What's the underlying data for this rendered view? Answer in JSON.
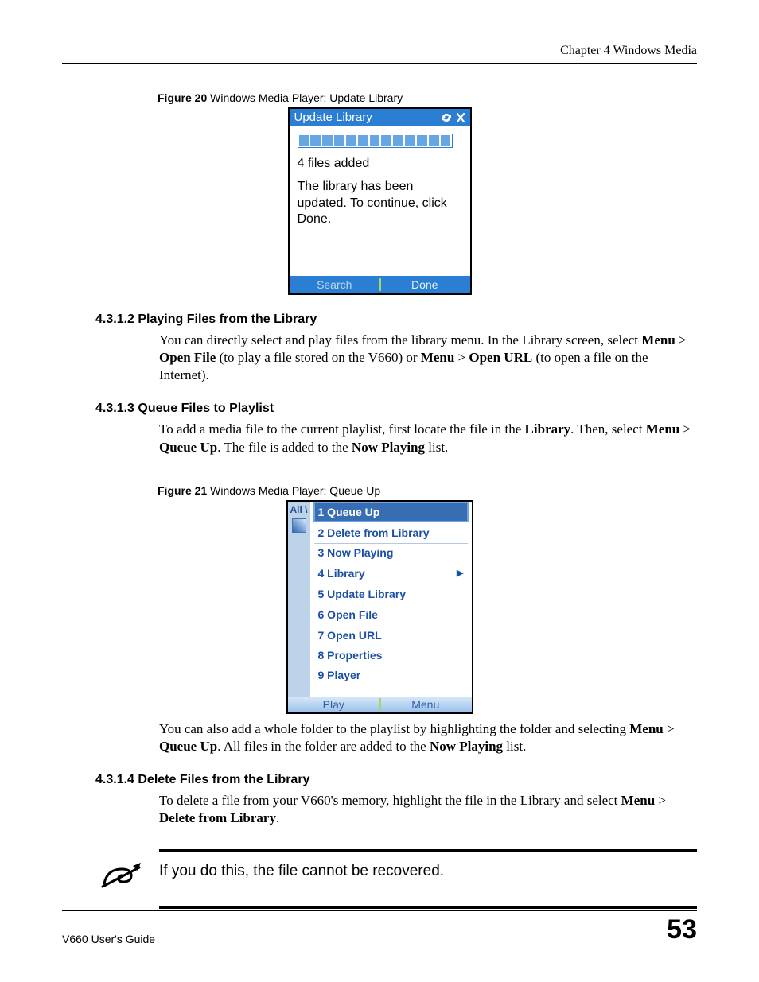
{
  "header": {
    "chapter": "Chapter 4 Windows Media"
  },
  "fig20": {
    "caption_bold": "Figure 20",
    "caption_rest": "   Windows Media Player: Update Library",
    "title": "Update Library",
    "status": "4 files added",
    "message": "The library has been updated. To continue, click Done.",
    "btn_left": "Search",
    "btn_right": "Done"
  },
  "sec4312": {
    "heading": "4.3.1.2  Playing Files from the Library",
    "p1a": "You can directly select and play files from the library menu. In the Library screen, select ",
    "menu": "Menu",
    "gt": " > ",
    "openfile": "Open File",
    "p1b": " (to play a file stored on the V660) or ",
    "openurl": "Open URL",
    "p1c": " (to open a file on the Internet)."
  },
  "sec4313": {
    "heading": "4.3.1.3  Queue Files to Playlist",
    "p1a": "To add a media file to the current playlist, first locate the file in the ",
    "library": "Library",
    "p1b": ". Then, select ",
    "menu": "Menu",
    "gt": " > ",
    "queueup": "Queue Up",
    "p1c": ". The file is added to the ",
    "nowplaying": "Now Playing",
    "p1d": " list."
  },
  "fig21": {
    "caption_bold": "Figure 21",
    "caption_rest": "   Windows Media Player: Queue Up",
    "left_label": "All \\",
    "items": {
      "i1": "1 Queue Up",
      "i2": "2 Delete from Library",
      "i3": "3 Now Playing",
      "i4": "4 Library",
      "i5": "5 Update Library",
      "i6": "6 Open File",
      "i7": "7 Open URL",
      "i8": "8 Properties",
      "i9": "9 Player"
    },
    "btn_left": "Play",
    "btn_right": "Menu"
  },
  "after_fig21": {
    "p1a": "You can also add a whole folder to the playlist by highlighting the folder and selecting ",
    "menu": "Menu",
    "gt": " > ",
    "queueup": "Queue Up",
    "p1b": ". All files in the folder are added to the ",
    "nowplaying": "Now Playing",
    "p1c": " list."
  },
  "sec4314": {
    "heading": "4.3.1.4  Delete Files from the Library",
    "p1a": "To delete a file from your V660's memory, highlight the file in the Library and select ",
    "menu": "Menu",
    "gt": " > ",
    "delete": "Delete from Library",
    "p1b": "."
  },
  "note": {
    "text": "If you do this, the file cannot be recovered."
  },
  "footer": {
    "guide": "V660 User's Guide",
    "page": "53"
  }
}
